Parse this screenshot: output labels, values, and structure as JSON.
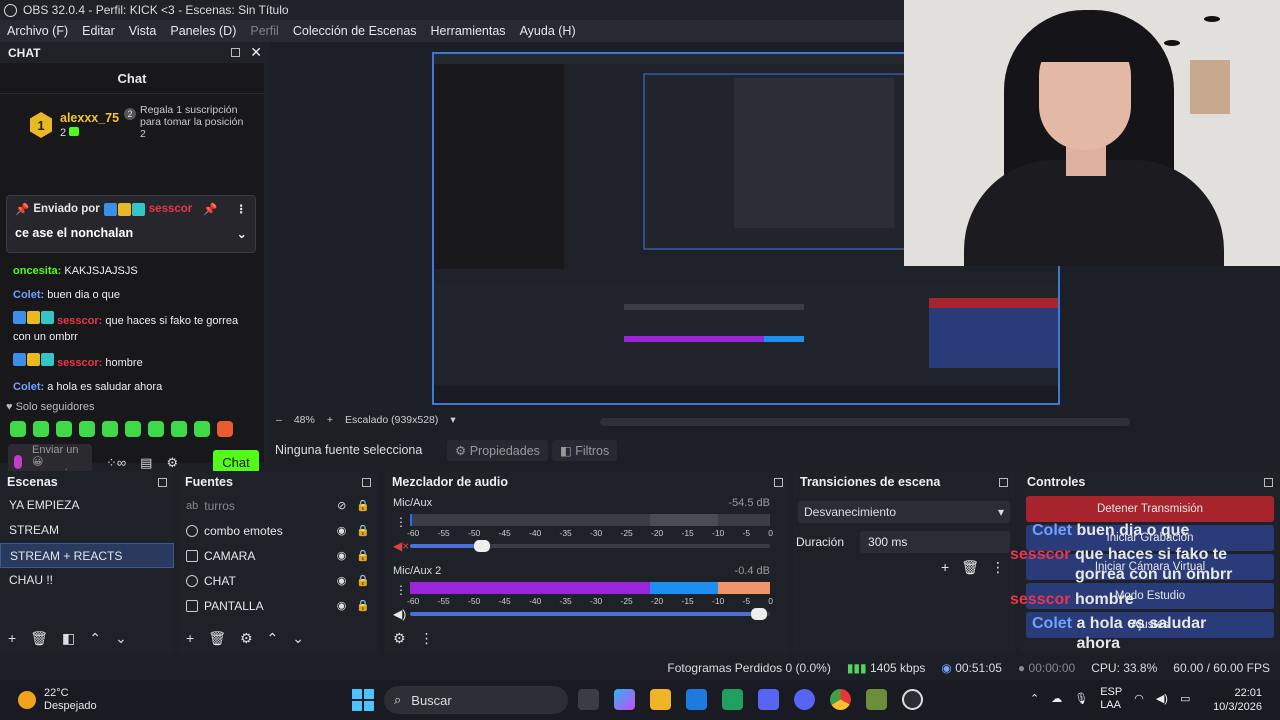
{
  "window": {
    "title": "OBS 32.0.4 - Perfil: KICK <3 - Escenas: Sin Título"
  },
  "menu": [
    "Archivo (F)",
    "Editar",
    "Vista",
    "Paneles (D)",
    "Perfil",
    "Colección de Escenas",
    "Herramientas",
    "Ayuda (H)"
  ],
  "chat_dock": {
    "label": "CHAT",
    "title": "Chat",
    "leader": {
      "rank": "1",
      "name": "alexxx_75",
      "count": "2",
      "gift_num": "2",
      "gift_text": "Regala 1 suscripción para tomar la posición 2"
    },
    "pinned": {
      "sent_by": "Enviado por",
      "user": "sesscor",
      "text": "ce ase el nonchalan"
    },
    "messages": [
      {
        "user": "oncesita:",
        "text": " KAKJSJAJSJS",
        "color": "green"
      },
      {
        "user": "Colet:",
        "text": " buen dia o que",
        "color": "blue"
      },
      {
        "user": "sesscor:",
        "text": " que haces si fako te gorrea con un ombrr",
        "color": "red"
      },
      {
        "user": "sesscor:",
        "text": " hombre",
        "color": "red"
      },
      {
        "user": "Colet:",
        "text": " a hola es saludar ahora",
        "color": "blue"
      }
    ],
    "followers": "Solo seguidores",
    "send_placeholder": "Enviar un 😀 mensaje",
    "chat_button": "Chat"
  },
  "preview": {
    "zoom": "48%",
    "scaling": "Escalado (939x528)"
  },
  "props_bar": {
    "no_source": "Ninguna fuente selecciona",
    "properties": "Propiedades",
    "filters": "Filtros"
  },
  "scenes": {
    "title": "Escenas",
    "items": [
      "YA EMPIEZA",
      "STREAM",
      "STREAM + REACTS",
      "CHAU !!"
    ],
    "selected": 2
  },
  "sources": {
    "title": "Fuentes",
    "items": [
      "turros",
      "combo emotes",
      "CAMARA",
      "CHAT",
      "PANTALLA"
    ]
  },
  "mixer": {
    "title": "Mezclador de audio",
    "tracks": [
      {
        "name": "Mic/Aux",
        "db": "-54.5 dB",
        "fader": 0.2
      },
      {
        "name": "Mic/Aux 2",
        "db": "-0.4 dB",
        "fader": 0.97
      }
    ],
    "ticks": [
      "-60",
      "-55",
      "-50",
      "-45",
      "-40",
      "-35",
      "-30",
      "-25",
      "-20",
      "-15",
      "-10",
      "-5",
      "0"
    ]
  },
  "transitions": {
    "title": "Transiciones de escena",
    "selected": "Desvanecimiento",
    "duration_label": "Duración",
    "duration": "300 ms"
  },
  "controls": {
    "title": "Controles",
    "buttons": [
      "Detener Transmisión",
      "Iniciar Grabación",
      "Iniciar Cámara Virtual",
      "Modo Estudio",
      "Ajustes"
    ]
  },
  "overlay_chat": [
    {
      "user": "Colet",
      "text": "buen dia o que"
    },
    {
      "user": "sesscor",
      "text": "que haces si fako te gorrea con un ombrr"
    },
    {
      "user": "sesscor",
      "text": "hombre"
    },
    {
      "user": "Colet",
      "text": "a hola es saludar ahora"
    }
  ],
  "status": {
    "dropped": "Fotogramas Perdidos 0 (0.0%)",
    "kbps": "1405 kbps",
    "stream_time": "00:51:05",
    "rec_time": "00:00:00",
    "cpu": "CPU: 33.8%",
    "fps": "60.00 / 60.00 FPS"
  },
  "taskbar": {
    "temp": "22°C",
    "weather": "Despejado",
    "search": "Buscar",
    "lang1": "ESP",
    "lang2": "LAA",
    "time": "22:01",
    "date": "10/3/2026"
  },
  "colors": {
    "accent_green": "#53fc18",
    "selection_blue": "#3f78d6",
    "stop_red": "#a8242d",
    "user_red": "#e8374a",
    "user_blue": "#6fa1ff"
  }
}
